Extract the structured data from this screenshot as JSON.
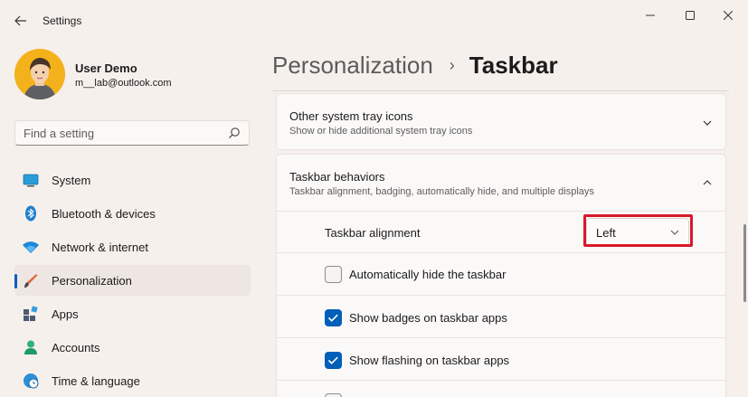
{
  "window": {
    "title": "Settings",
    "controls": {
      "minimize": "minimize",
      "maximize": "maximize",
      "close": "close"
    }
  },
  "user": {
    "name": "User Demo",
    "email": "m__lab@outlook.com"
  },
  "search": {
    "placeholder": "Find a setting"
  },
  "sidebar": {
    "items": [
      {
        "label": "System",
        "icon": "system-icon"
      },
      {
        "label": "Bluetooth & devices",
        "icon": "bluetooth-icon"
      },
      {
        "label": "Network & internet",
        "icon": "wifi-icon"
      },
      {
        "label": "Personalization",
        "icon": "brush-icon",
        "active": true
      },
      {
        "label": "Apps",
        "icon": "apps-icon"
      },
      {
        "label": "Accounts",
        "icon": "accounts-icon"
      },
      {
        "label": "Time & language",
        "icon": "globe-clock-icon"
      }
    ]
  },
  "breadcrumb": {
    "parent": "Personalization",
    "separator": "›",
    "current": "Taskbar"
  },
  "main": {
    "tray_card": {
      "title": "Other system tray icons",
      "subtitle": "Show or hide additional system tray icons",
      "expanded": false
    },
    "behaviors_card": {
      "title": "Taskbar behaviors",
      "subtitle": "Taskbar alignment, badging, automatically hide, and multiple displays",
      "expanded": true
    },
    "alignment": {
      "label": "Taskbar alignment",
      "value": "Left",
      "highlighted": true
    },
    "checkboxes": [
      {
        "label": "Automatically hide the taskbar",
        "checked": false
      },
      {
        "label": "Show badges on taskbar apps",
        "checked": true
      },
      {
        "label": "Show flashing on taskbar apps",
        "checked": true
      }
    ]
  },
  "colors": {
    "accent": "#005fb8",
    "highlight": "#d7182a",
    "background": "#f6f0ec"
  }
}
